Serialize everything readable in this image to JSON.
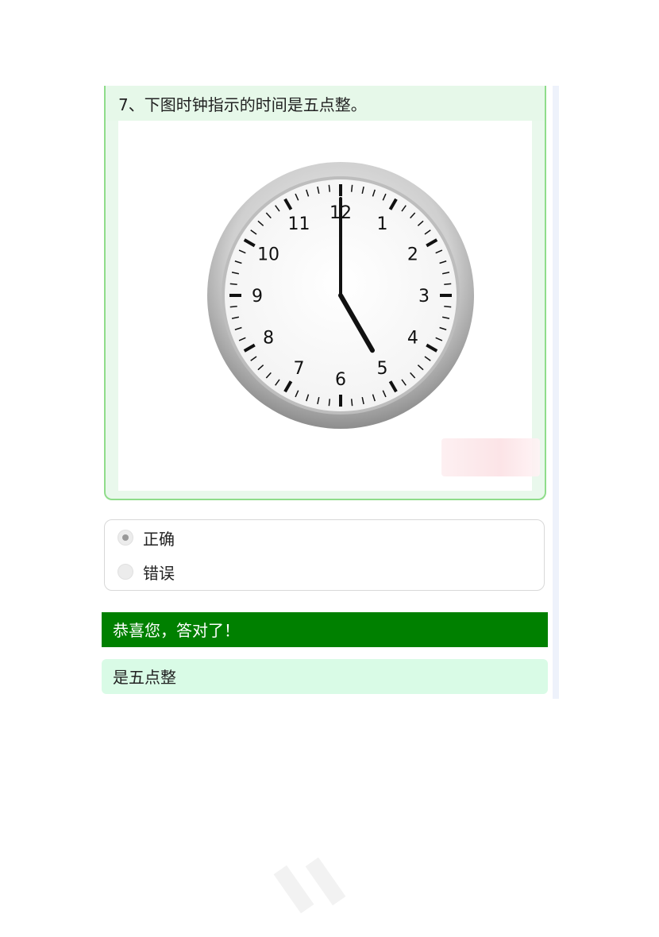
{
  "question": {
    "text": "7、下图时钟指示的时间是五点整。",
    "clock": {
      "numbers": [
        "12",
        "1",
        "2",
        "3",
        "4",
        "5",
        "6",
        "7",
        "8",
        "9",
        "10",
        "11"
      ],
      "time_hour": 5,
      "time_minute": 0
    }
  },
  "options": [
    {
      "label": "正确",
      "selected": true
    },
    {
      "label": "错误",
      "selected": false
    }
  ],
  "result": {
    "message": "恭喜您，答对了！",
    "color": "#008000"
  },
  "explanation": {
    "text": "是五点整"
  }
}
